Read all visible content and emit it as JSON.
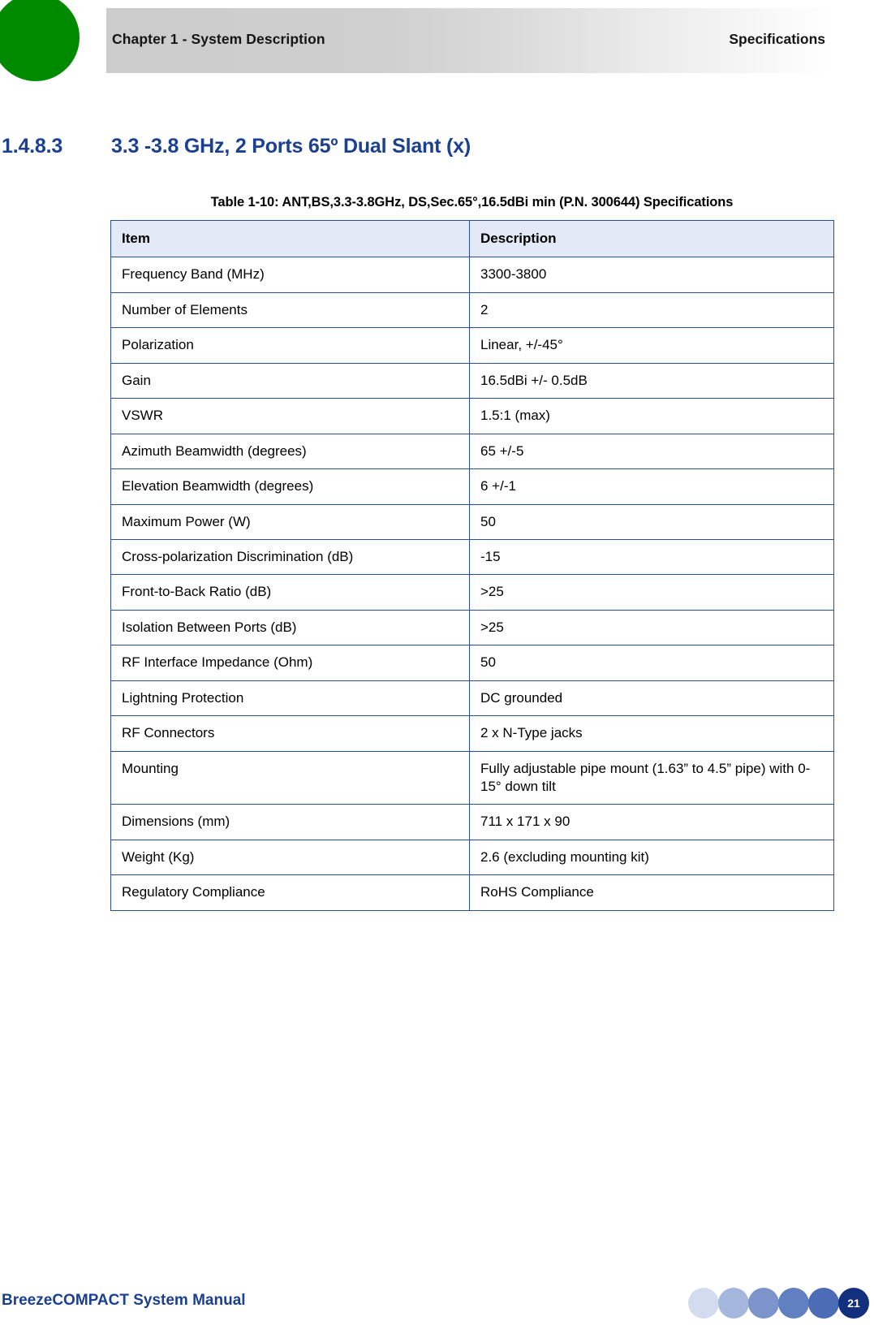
{
  "header": {
    "chapter": "Chapter 1 - System Description",
    "section": "Specifications",
    "dot_color": "#008a00"
  },
  "heading": {
    "number": "1.4.8.3",
    "title": "3.3 -3.8 GHz, 2 Ports 65º Dual Slant (x)",
    "color": "#1b3f91"
  },
  "table": {
    "caption": "Table 1-10: ANT,BS,3.3-3.8GHz, DS,Sec.65°,16.5dBi min (P.N. 300644) Specifications",
    "columns": [
      "Item",
      "Description"
    ],
    "header_bg": "#e3e9f6",
    "border_color": "#2b4e9b",
    "rows": [
      {
        "item": "Frequency Band (MHz)",
        "description": "3300-3800"
      },
      {
        "item": "Number of Elements",
        "description": "2"
      },
      {
        "item": "Polarization",
        "description": "Linear, +/-45°"
      },
      {
        "item": "Gain",
        "description": "16.5dBi +/- 0.5dB"
      },
      {
        "item": "VSWR",
        "description": "1.5:1 (max)"
      },
      {
        "item": "Azimuth Beamwidth (degrees)",
        "description": "65 +/-5"
      },
      {
        "item": "Elevation Beamwidth (degrees)",
        "description": "6 +/-1"
      },
      {
        "item": "Maximum Power (W)",
        "description": "50"
      },
      {
        "item": "Cross-polarization Discrimination (dB)",
        "description": "-15"
      },
      {
        "item": "Front-to-Back Ratio (dB)",
        "description": ">25"
      },
      {
        "item": "Isolation Between Ports (dB)",
        "description": ">25"
      },
      {
        "item": "RF Interface Impedance (Ohm)",
        "description": "50"
      },
      {
        "item": "Lightning Protection",
        "description": "DC grounded"
      },
      {
        "item": "RF Connectors",
        "description": "2 x N-Type jacks"
      },
      {
        "item": "Mounting",
        "description": "Fully adjustable pipe mount (1.63” to 4.5” pipe) with 0-15° down tilt"
      },
      {
        "item": "Dimensions (mm)",
        "description": "711 x 171 x 90"
      },
      {
        "item": "Weight (Kg)",
        "description": "2.6 (excluding mounting kit)"
      },
      {
        "item": "Regulatory Compliance",
        "description": "RoHS Compliance"
      }
    ]
  },
  "footer": {
    "manual_title": "BreezeCOMPACT System Manual",
    "page_number": "21",
    "dot_colors": [
      "#d3dcef",
      "#a6b7dd",
      "#7c94cb",
      "#6180c2",
      "#4c6cb5",
      "#12307e"
    ]
  }
}
